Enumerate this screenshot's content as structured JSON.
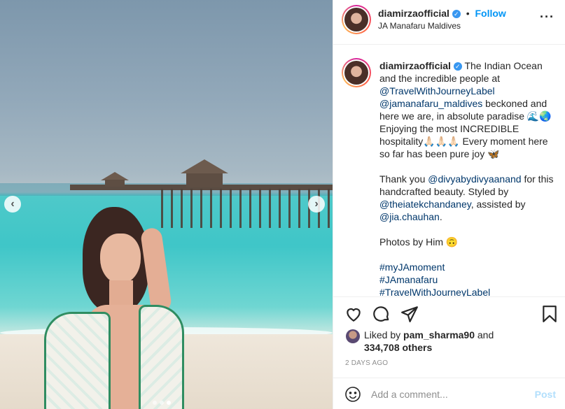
{
  "post": {
    "username": "diamirzaofficial",
    "verified_mark": "✓",
    "dot": "•",
    "follow_label": "Follow",
    "location": "JA Manafaru Maldives",
    "more_label": "···",
    "icons": {
      "prev": "chevron-left-icon",
      "next": "chevron-right-icon",
      "like": "heart-icon",
      "comment": "comment-icon",
      "share": "paper-plane-icon",
      "save": "bookmark-icon",
      "emoji": "smiley-icon"
    },
    "nav": {
      "prev": "‹",
      "next": "›"
    }
  },
  "caption": {
    "username": "diamirzaofficial",
    "line1_text": "The Indian Ocean and the incredible people at",
    "mention1": "@TravelWithJourneyLabel",
    "mention2": "@jamanafaru_maldives",
    "line2_text": "beckoned and here we are, in absolute paradise 🌊🌏 Enjoying the most INCREDIBLE hospitality🙏🏻🙏🏻🙏🏻 Every moment here so far has been pure joy 🦋",
    "p2_a": "Thank you",
    "mention3": "@divyabydivyaanand",
    "p2_b": "for this handcrafted beauty. Styled by",
    "mention4": "@theiatekchandaney",
    "p2_c": ", assisted by",
    "mention5": "@jia.chauhan",
    "p2_d": ".",
    "p3": "Photos by Him 🙃",
    "hashtags": [
      "#myJAmoment",
      "#JAmanafaru",
      "#TravelWithJourneyLabel"
    ]
  },
  "likes": {
    "liked_by": "Liked by",
    "user": "pam_sharma90",
    "and": "and",
    "others": "334,708 others"
  },
  "time": "2 DAYS AGO",
  "comment": {
    "placeholder": "Add a comment...",
    "post_label": "Post"
  },
  "colors": {
    "link": "#00376b",
    "follow": "#0095f6",
    "verified": "#3897f0",
    "post_disabled": "#b2dffc"
  }
}
